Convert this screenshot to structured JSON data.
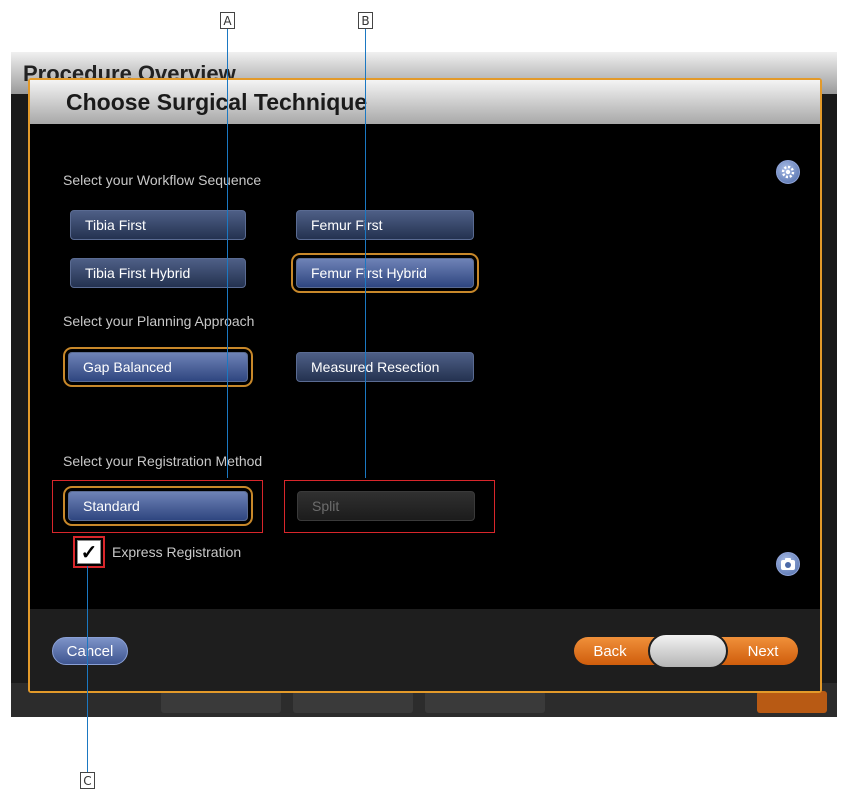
{
  "callouts": {
    "a": "A",
    "b": "B",
    "c": "C"
  },
  "background_window": {
    "title": "Procedure Overview"
  },
  "dialog": {
    "title": "Choose Surgical Technique",
    "workflow": {
      "label": "Select your Workflow Sequence",
      "options": [
        "Tibia First",
        "Femur First",
        "Tibia First Hybrid",
        "Femur First Hybrid"
      ],
      "selected": "Femur First Hybrid"
    },
    "planning": {
      "label": "Select your Planning Approach",
      "options": [
        "Gap Balanced",
        "Measured Resection"
      ],
      "selected": "Gap Balanced"
    },
    "registration": {
      "label": "Select your Registration Method",
      "options": [
        "Standard",
        "Split"
      ],
      "selected": "Standard",
      "disabled": [
        "Split"
      ]
    },
    "express_registration": {
      "label": "Express Registration",
      "checked": true,
      "check_glyph": "✓"
    },
    "icons": {
      "settings": "gear-icon",
      "screenshot": "camera-icon"
    },
    "footer": {
      "cancel": "Cancel",
      "back": "Back",
      "next": "Next"
    }
  },
  "colors": {
    "accent_orange": "#e39a2a",
    "selection_ring": "#c8882a",
    "callout_line": "#1b78c2",
    "highlight_red": "#d8262b",
    "button_blue": "#3a4c76"
  }
}
